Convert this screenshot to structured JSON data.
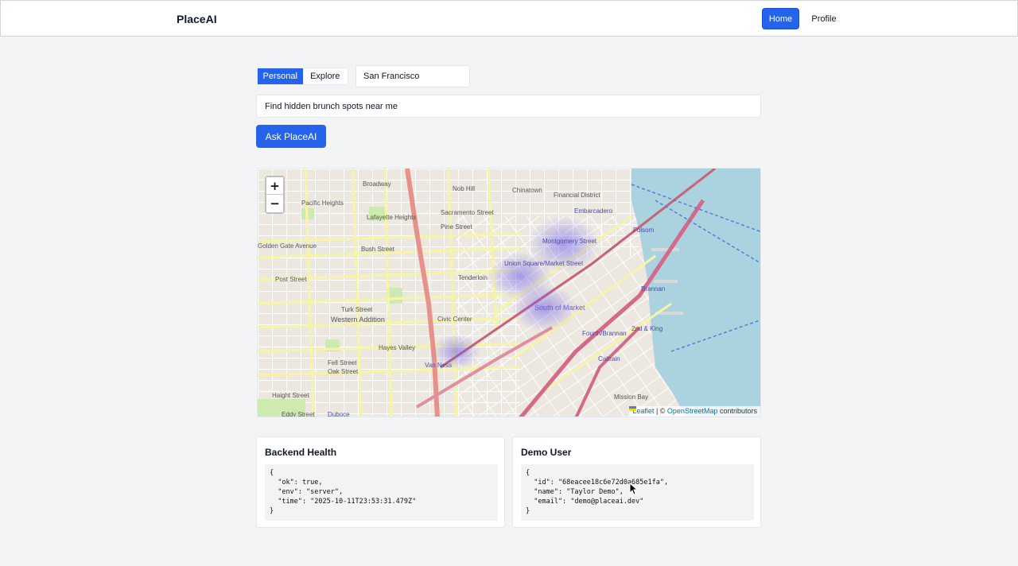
{
  "nav": {
    "brand": "PlaceAI",
    "home_label": "Home",
    "profile_label": "Profile"
  },
  "search": {
    "modes": [
      "Personal",
      "Explore"
    ],
    "active_mode": "Personal",
    "city_value": "San Francisco",
    "query_value": "Find hidden brunch spots near me",
    "ask_label": "Ask PlaceAI"
  },
  "map": {
    "zoom_in": "+",
    "zoom_out": "−",
    "attribution_leaflet": "Leaflet",
    "attribution_sep": " | © ",
    "attribution_osm": "OpenStreetMap",
    "attribution_tail": " contributors",
    "labels": [
      "Nob Hill",
      "Chinatown",
      "Financial District",
      "Embarcadero",
      "Pacific Heights",
      "Lafayette Heights",
      "Broadway",
      "Sacramento Street",
      "Pine Street",
      "Bush Street",
      "Montgomery Street",
      "Folsom",
      "Union Square/Market Street",
      "Tenderloin",
      "Post Street",
      "South of Market",
      "Brannan",
      "Turk Street",
      "Western Addition",
      "Civic Center",
      "Fourth/Brannan",
      "2nd & King",
      "Hayes Valley",
      "Fell Street",
      "Oak Street",
      "Van Ness",
      "Caltrain",
      "Haight Street",
      "Mission Bay",
      "Duboce",
      "Eddy Street",
      "Golden Gate Avenue"
    ],
    "heat_color": "#6b5ce7",
    "water_color": "#aad3df"
  },
  "health": {
    "title": "Backend Health",
    "json": "{\n  \"ok\": true,\n  \"env\": \"server\",\n  \"time\": \"2025-10-11T23:53:31.479Z\"\n}"
  },
  "user": {
    "title": "Demo User",
    "json": "{\n  \"id\": \"68eacee18c6e72d0a685e1fa\",\n  \"name\": \"Taylor Demo\",\n  \"email\": \"demo@placeai.dev\"\n}"
  },
  "colors": {
    "primary": "#2563eb",
    "background": "#f3f4f6"
  }
}
